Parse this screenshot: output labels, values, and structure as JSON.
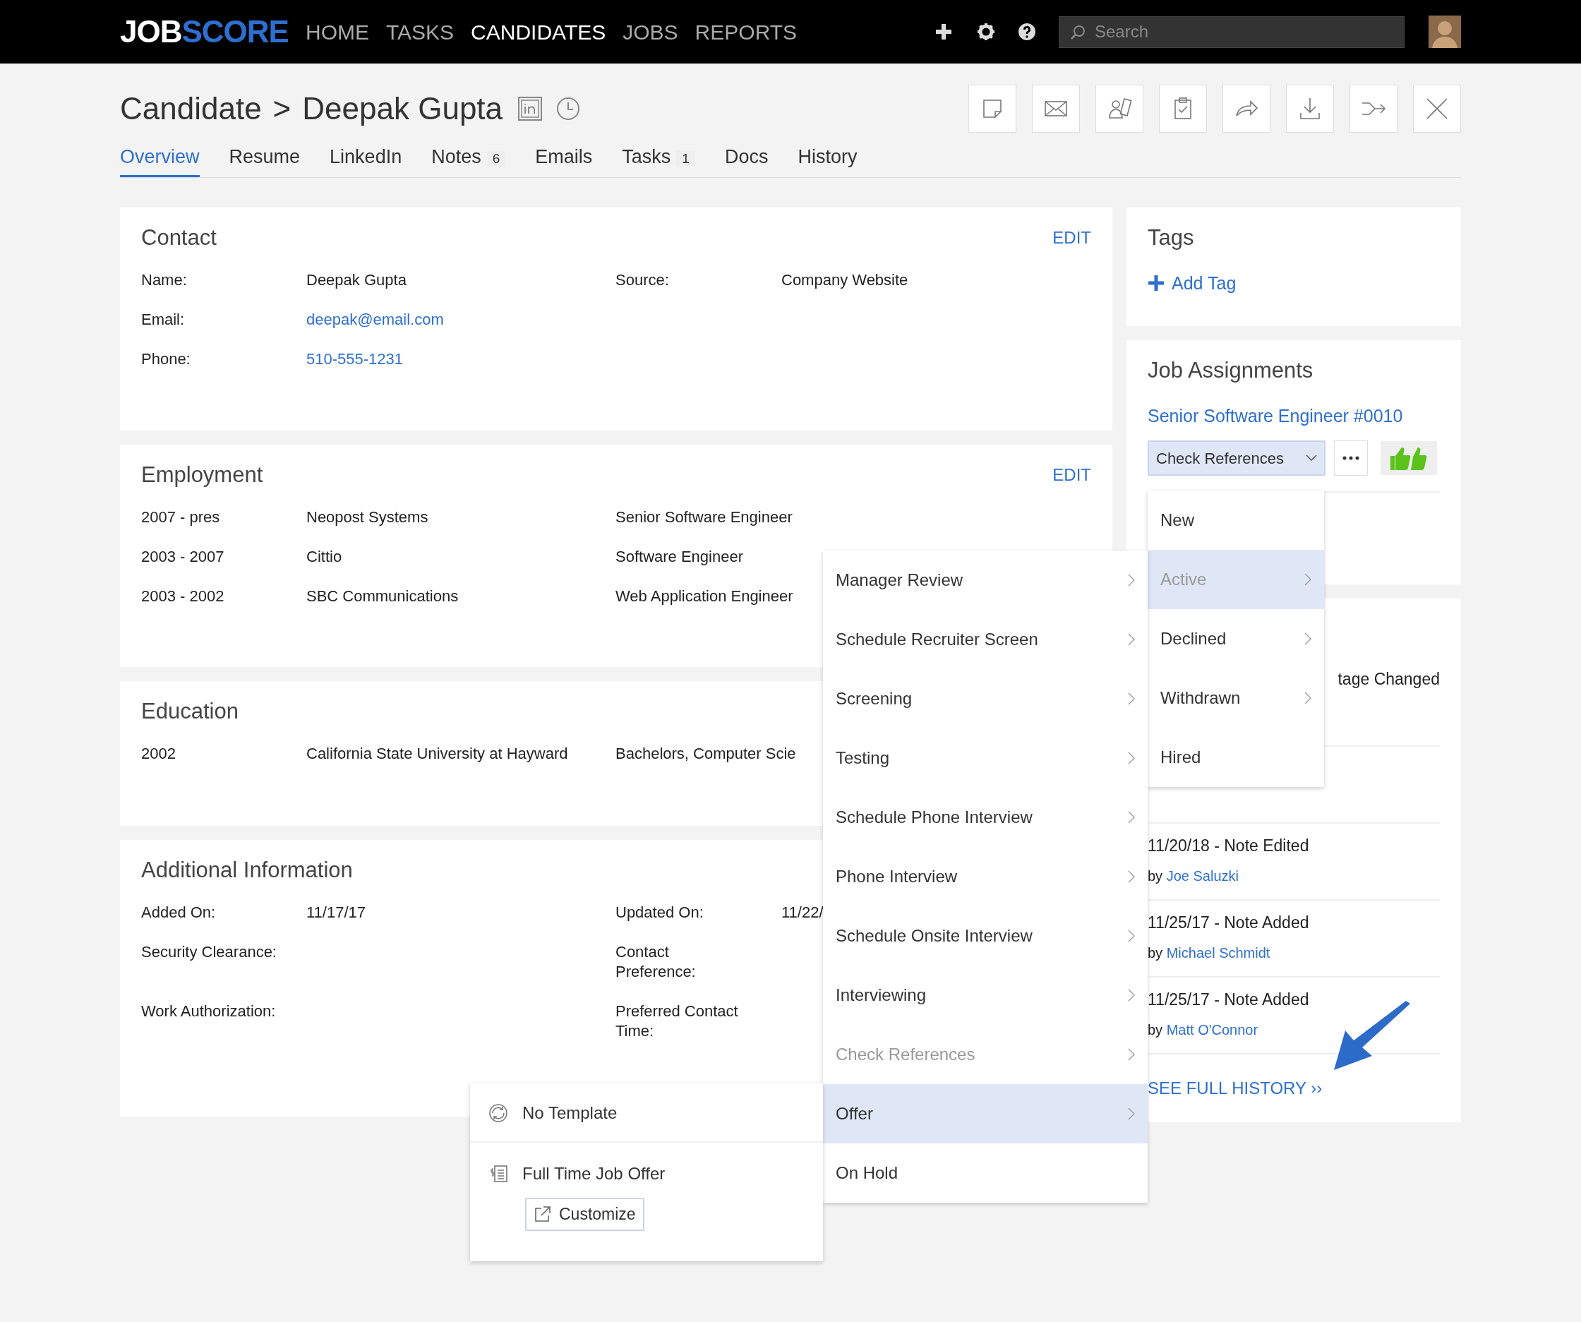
{
  "navbar": {
    "logo_parts": [
      "JOB",
      "SCORE"
    ],
    "items": [
      {
        "label": "HOME",
        "selected": false
      },
      {
        "label": "TASKS",
        "selected": false
      },
      {
        "label": "CANDIDATES",
        "selected": true
      },
      {
        "label": "JOBS",
        "selected": false
      },
      {
        "label": "REPORTS",
        "selected": false
      }
    ],
    "search": {
      "placeholder": "Search"
    }
  },
  "header": {
    "breadcrumb": "Candidate",
    "separator": ">",
    "name": "Deepak Gupta"
  },
  "tabs": [
    {
      "label": "Overview",
      "selected": true
    },
    {
      "label": "Resume",
      "selected": false
    },
    {
      "label": "LinkedIn",
      "selected": false
    },
    {
      "label": "Notes",
      "count": "6",
      "selected": false
    },
    {
      "label": "Emails",
      "selected": false
    },
    {
      "label": "Tasks",
      "count": "1",
      "selected": false
    },
    {
      "label": "Docs",
      "selected": false
    },
    {
      "label": "History",
      "selected": false
    }
  ],
  "contact": {
    "title": "Contact",
    "edit": "EDIT",
    "rows": [
      [
        {
          "label": "Name:",
          "value": "Deepak Gupta",
          "kind": "text"
        },
        {
          "label": "Source:",
          "value": "Company Website",
          "kind": "text"
        }
      ],
      [
        {
          "label": "Email:",
          "value": "deepak@email.com",
          "kind": "link"
        }
      ],
      [
        {
          "label": "Phone:",
          "value": "510-555-1231",
          "kind": "link"
        }
      ]
    ]
  },
  "employment": {
    "title": "Employment",
    "edit": "EDIT",
    "rows": [
      [
        "2007 - pres",
        "Neopost Systems",
        "Senior Software Engineer"
      ],
      [
        "2003 - 2007",
        "Cittio",
        "Software Engineer"
      ],
      [
        "2003 - 2002",
        "SBC Communications",
        "Web Application Engineer"
      ]
    ]
  },
  "education": {
    "title": "Education",
    "rows": [
      [
        "2002",
        "California State University at Hayward",
        "Bachelors, Computer Scie"
      ]
    ]
  },
  "additional": {
    "title": "Additional Information",
    "rows": [
      [
        {
          "label": "Added On:",
          "value": "11/17/17"
        },
        {
          "label": "Updated On:",
          "value": "11/22/"
        }
      ],
      [
        {
          "label": "Security Clearance:"
        },
        {
          "label": "Contact Preference:"
        }
      ],
      [
        {
          "label": "Work Authorization:"
        },
        {
          "label": "Preferred Contact Time:"
        }
      ]
    ]
  },
  "tags": {
    "title": "Tags",
    "add_label": "Add Tag"
  },
  "job_assignments": {
    "title": "Job Assignments",
    "job": "Senior Software Engineer #0010",
    "stage": {
      "label": "Check References",
      "expanded": true
    }
  },
  "history": {
    "items": [
      {
        "title": "tage Changed"
      },
      {
        "title": "11/20/18 - Note Edited",
        "by": "by",
        "author": "Joe Saluzki"
      },
      {
        "title": "11/25/17 - Note Added",
        "by": "by",
        "author": "Michael Schmidt"
      },
      {
        "title": "11/25/17 - Note Added",
        "by": "by",
        "author": "Matt O'Connor"
      }
    ],
    "see_all": "SEE FULL HISTORY ››"
  },
  "stage_menu": [
    {
      "label": "New",
      "submenu": false,
      "highlighted": false,
      "current": false
    },
    {
      "label": "Active",
      "submenu": true,
      "highlighted": true,
      "current": true
    },
    {
      "label": "Declined",
      "submenu": true,
      "highlighted": false,
      "current": false
    },
    {
      "label": "Withdrawn",
      "submenu": true,
      "highlighted": false,
      "current": false
    },
    {
      "label": "Hired",
      "submenu": false,
      "highlighted": false,
      "current": false
    }
  ],
  "active_submenu": [
    {
      "label": "Manager Review",
      "submenu": true,
      "highlighted": false,
      "current": false
    },
    {
      "label": "Schedule Recruiter Screen",
      "submenu": true,
      "highlighted": false,
      "current": false
    },
    {
      "label": "Screening",
      "submenu": true,
      "highlighted": false,
      "current": false
    },
    {
      "label": "Testing",
      "submenu": true,
      "highlighted": false,
      "current": false
    },
    {
      "label": "Schedule Phone Interview",
      "submenu": true,
      "highlighted": false,
      "current": false
    },
    {
      "label": "Phone Interview",
      "submenu": true,
      "highlighted": false,
      "current": false
    },
    {
      "label": "Schedule Onsite Interview",
      "submenu": true,
      "highlighted": false,
      "current": false
    },
    {
      "label": "Interviewing",
      "submenu": true,
      "highlighted": false,
      "current": false
    },
    {
      "label": "Check References",
      "submenu": true,
      "highlighted": false,
      "current": true
    },
    {
      "label": "Offer",
      "submenu": true,
      "highlighted": true,
      "current": false
    },
    {
      "label": "On Hold",
      "submenu": false,
      "highlighted": false,
      "current": false
    }
  ],
  "offer_templates": [
    {
      "label": "No Template",
      "kind": "none"
    },
    {
      "label": "Full Time Job Offer",
      "kind": "document",
      "action": "Customize"
    }
  ]
}
